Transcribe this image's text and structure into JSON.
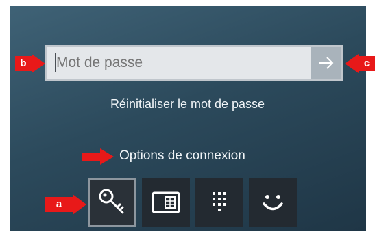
{
  "password": {
    "placeholder": "Mot de passe",
    "value": ""
  },
  "submit": {
    "icon": "arrow-right-icon"
  },
  "reset_link": "Réinitialiser le mot de passe",
  "options_label": "Options de connexion",
  "sign_in_options": [
    {
      "icon": "key-icon",
      "selected": true
    },
    {
      "icon": "smart-card-icon",
      "selected": false
    },
    {
      "icon": "pin-keypad-icon",
      "selected": false
    },
    {
      "icon": "face-icon",
      "selected": false
    }
  ],
  "annotations": [
    "a",
    "b",
    "c"
  ],
  "colors": {
    "marker": "#e81919",
    "text": "#f0f4f7",
    "tile": "#232a31"
  }
}
